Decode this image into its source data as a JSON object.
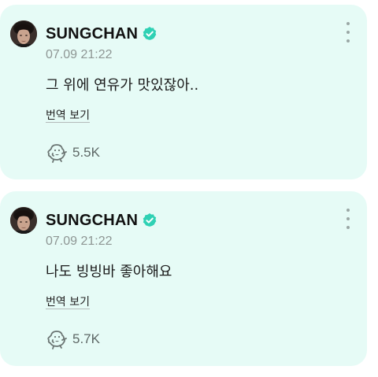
{
  "posts": [
    {
      "author": "SUNGCHAN",
      "timestamp": "07.09 21:22",
      "text": "그 위에 연유가 맛있잖아..",
      "translate_label": "번역 보기",
      "like_count": "5.5K"
    },
    {
      "author": "SUNGCHAN",
      "timestamp": "07.09 21:22",
      "text": "나도 빙빙바 좋아해요",
      "translate_label": "번역 보기",
      "like_count": "5.7K"
    }
  ],
  "colors": {
    "card_background": "#e6fbf6",
    "verified_badge": "#2fd1b4",
    "muted_text": "#8e9694"
  },
  "icons": {
    "verified": "verified-badge-icon",
    "more": "more-vertical-icon",
    "reaction": "dancing-dino-reaction-icon"
  }
}
